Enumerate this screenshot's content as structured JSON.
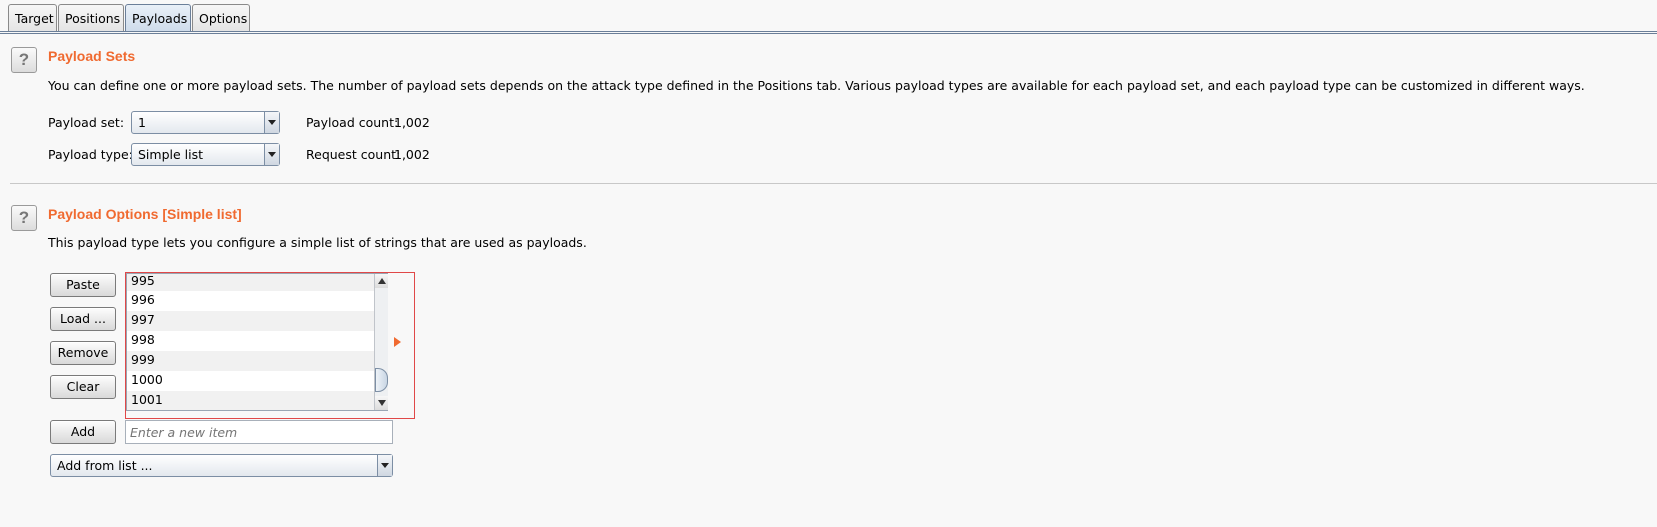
{
  "tabs": [
    {
      "label": "Target"
    },
    {
      "label": "Positions"
    },
    {
      "label": "Payloads",
      "active": true
    },
    {
      "label": "Options"
    }
  ],
  "payload_sets": {
    "title": "Payload Sets",
    "description": "You can define one or more payload sets. The number of payload sets depends on the attack type defined in the Positions tab. Various payload types are available for each payload set, and each payload type can be customized in different ways.",
    "set_label": "Payload set:",
    "set_value": "1",
    "type_label": "Payload type:",
    "type_value": "Simple list",
    "payload_count_label": "Payload count:",
    "payload_count": "1,002",
    "request_count_label": "Request count:",
    "request_count": "1,002"
  },
  "payload_options": {
    "title": "Payload Options [Simple list]",
    "description": "This payload type lets you configure a simple list of strings that are used as payloads.",
    "buttons": {
      "paste": "Paste",
      "load": "Load ...",
      "remove": "Remove",
      "clear": "Clear",
      "add": "Add"
    },
    "list_items": [
      "995",
      "996",
      "997",
      "998",
      "999",
      "1000",
      "1001"
    ],
    "new_item_placeholder": "Enter a new item",
    "add_from_list": "Add from list ..."
  },
  "colors": {
    "accent": "#f06a30",
    "highlight_border": "#e04848"
  }
}
